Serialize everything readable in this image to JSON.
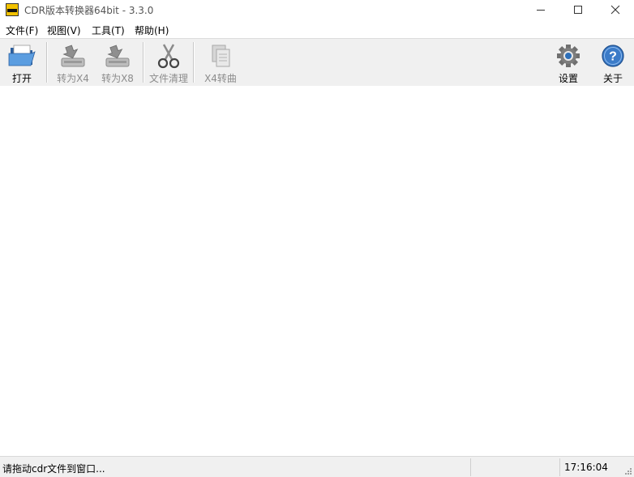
{
  "window": {
    "title": "CDR版本转换器64bit - 3.3.0",
    "app_icon_text": "CDR Version"
  },
  "menu": [
    {
      "label": "文件(F)"
    },
    {
      "label": "视图(V)"
    },
    {
      "label": "工具(T)"
    },
    {
      "label": "帮助(H)"
    }
  ],
  "toolbar": {
    "open_label": "打开",
    "to_x4_label": "转为X4",
    "to_x8_label": "转为X8",
    "clean_label": "文件清理",
    "x4_curve_label": "X4转曲",
    "settings_label": "设置",
    "about_label": "关于"
  },
  "statusbar": {
    "message": "请拖动cdr文件到窗口...",
    "time": "17:16:04"
  },
  "colors": {
    "toolbar_bg": "#f0f0f0",
    "folder_blue": "#3a78c8",
    "accent_blue": "#2e6fb8",
    "disabled_text": "#8c8c8c"
  }
}
